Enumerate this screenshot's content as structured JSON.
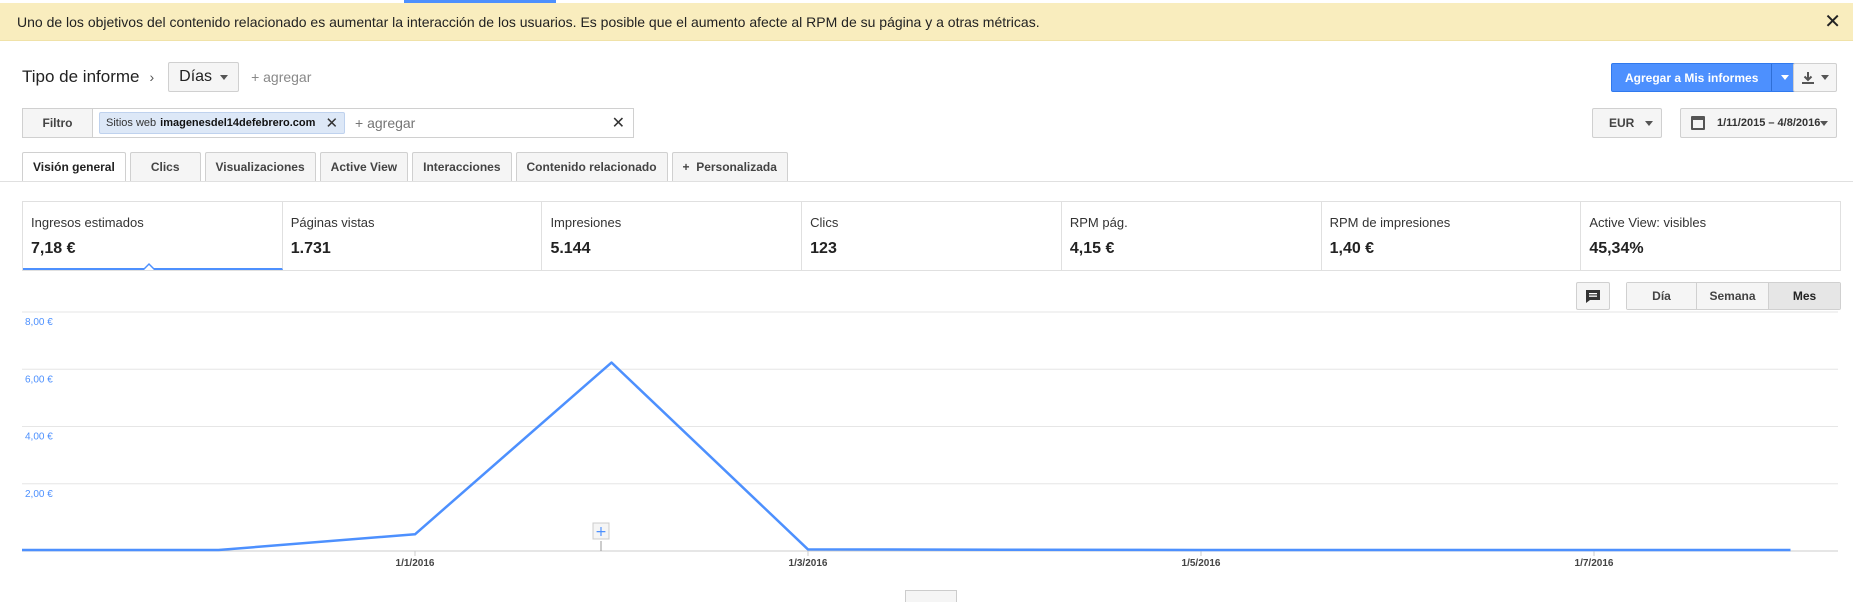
{
  "banner": {
    "text": "Uno de los objetivos del contenido relacionado es aumentar la interacción de los usuarios. Es posible que el aumento afecte al RPM de su página y a otras métricas.",
    "close_icon": "close-icon"
  },
  "report": {
    "label": "Tipo de informe",
    "dimension": "Días",
    "add_label": "+ agregar"
  },
  "actions": {
    "add_to_reports": "Agregar a Mis informes",
    "download_icon": "download-icon"
  },
  "filter": {
    "label": "Filtro",
    "chip_prefix": "Sitios web",
    "chip_value": "imagenesdel14defebrero.com",
    "placeholder": "+ agregar"
  },
  "currency": "EUR",
  "date_range": "1/11/2015 – 4/8/2016",
  "tabs": [
    {
      "label": "Visión general",
      "active": true
    },
    {
      "label": "Clics"
    },
    {
      "label": "Visualizaciones"
    },
    {
      "label": "Active View"
    },
    {
      "label": "Interacciones"
    },
    {
      "label": "Contenido relacionado"
    },
    {
      "label": "+  Personalizada"
    }
  ],
  "metrics": [
    {
      "label": "Ingresos estimados",
      "value": "7,18 €"
    },
    {
      "label": "Páginas vistas",
      "value": "1.731"
    },
    {
      "label": "Impresiones",
      "value": "5.144"
    },
    {
      "label": "Clics",
      "value": "123"
    },
    {
      "label": "RPM pág.",
      "value": "4,15 €"
    },
    {
      "label": "RPM de impresiones",
      "value": "1,40 €"
    },
    {
      "label": "Active View: visibles",
      "value": "45,34%"
    }
  ],
  "period": {
    "options": [
      "Día",
      "Semana",
      "Mes"
    ],
    "selected": "Mes"
  },
  "accent": "#4d90fe",
  "chart_data": {
    "type": "line",
    "y_ticks": [
      "8,00 €",
      "6,00 €",
      "4,00 €",
      "2,00 €"
    ],
    "x_ticks": [
      "1/1/2016",
      "1/3/2016",
      "1/5/2016",
      "1/7/2016"
    ],
    "ylim": [
      0,
      8
    ],
    "series": [
      {
        "x": [
          "2015-11",
          "2015-12",
          "2016-01",
          "2016-02",
          "2016-03",
          "2016-04",
          "2016-05",
          "2016-06",
          "2016-07",
          "2016-08"
        ],
        "values": [
          0.0,
          0.0,
          0.55,
          6.55,
          0.02,
          0.01,
          0.0,
          0.0,
          0.0,
          0.0
        ]
      }
    ]
  }
}
